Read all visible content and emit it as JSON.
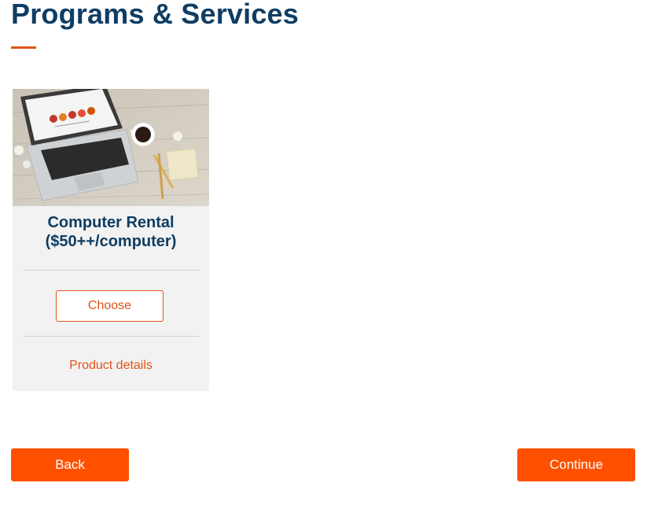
{
  "header": {
    "title": "Programs & Services",
    "accent_color": "#e0531a",
    "title_color": "#0f3d63"
  },
  "products": [
    {
      "image_icon": "laptop-on-desk-photo",
      "name_line1": "Computer Rental",
      "name_line2": "($50++/computer)",
      "choose_label": "Choose",
      "details_label": "Product details"
    }
  ],
  "footer": {
    "back_label": "Back",
    "continue_label": "Continue",
    "button_color": "#ff5000"
  }
}
